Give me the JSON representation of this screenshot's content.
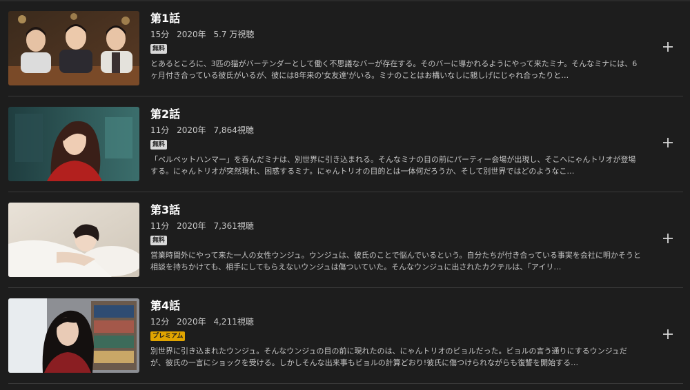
{
  "episodes": [
    {
      "title": "第1話",
      "duration": "15分",
      "year": "2020年",
      "views": "5.7 万視聴",
      "badge": "無料",
      "badge_type": "free",
      "description": "とあるところに、3匹の猫がバーテンダーとして働く不思議なバーが存在する。そのバーに導かれるようにやって来たミナ。そんなミナには、6ヶ月付き合っている彼氏がいるが、彼には8年来の'女友達'がいる。ミナのことはお構いなしに親しげにじゃれ合ったりと…"
    },
    {
      "title": "第2話",
      "duration": "11分",
      "year": "2020年",
      "views": "7,864視聴",
      "badge": "無料",
      "badge_type": "free",
      "description": "「ベルベットハンマー」を呑んだミナは、別世界に引き込まれる。そんなミナの目の前にパーティー会場が出現し、そこへにゃんトリオが登場する。にゃんトリオが突然現れ、困惑するミナ。にゃんトリオの目的とは一体何だろうか、そして別世界ではどのようなこ…"
    },
    {
      "title": "第3話",
      "duration": "11分",
      "year": "2020年",
      "views": "7,361視聴",
      "badge": "無料",
      "badge_type": "free",
      "description": "営業時間外にやって来た一人の女性ウンジュ。ウンジュは、彼氏のことで悩んでいるという。自分たちが付き合っている事実を会社に明かそうと相談を持ちかけても、相手にしてもらえないウンジュは傷ついていた。そんなウンジュに出されたカクテルは、「アイリ…"
    },
    {
      "title": "第4話",
      "duration": "12分",
      "year": "2020年",
      "views": "4,211視聴",
      "badge": "プレミアム",
      "badge_type": "premium",
      "description": "別世界に引き込まれたウンジュ。そんなウンジュの目の前に現れたのは、にゃんトリオのビョルだった。ビョルの言う通りにするウンジュだが、彼氏の一言にショックを受ける。しかしそんな出来事もビョルの計算どおり!彼氏に傷つけられながらも復讐を開始する…"
    }
  ],
  "colors": {
    "background": "#1d1d1d",
    "free_badge": "#d8d8d8",
    "premium_badge": "#e0a400"
  },
  "icons": {
    "add": "plus-icon"
  }
}
